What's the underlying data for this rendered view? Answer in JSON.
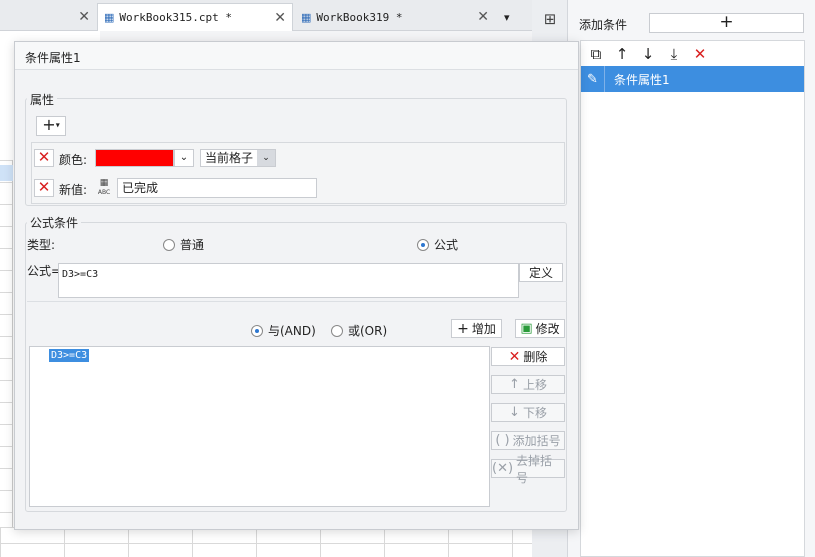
{
  "tabs": [
    {
      "label": "",
      "active": false
    },
    {
      "label": "WorkBook315.cpt *",
      "active": true
    },
    {
      "label": "WorkBook319 *",
      "active": false
    }
  ],
  "panel": {
    "add_condition_label": "添加条件",
    "add_condition_button": "+",
    "items": [
      {
        "label": "条件属性1",
        "selected": true
      }
    ]
  },
  "dialog": {
    "title": "条件属性1",
    "attributes": {
      "title": "属性",
      "add_button": "+",
      "color_label": "颜色:",
      "color_value": "#ff0000",
      "scope_value": "当前格子",
      "new_value_label": "新值:",
      "new_value_icon_text": "ABC",
      "new_value": "已完成"
    },
    "formula_condition": {
      "title": "公式条件",
      "type_label": "类型:",
      "type_normal": "普通",
      "type_formula": "公式",
      "selected_type": "公式",
      "formula_label": "公式=",
      "formula_value": "D3>=C3",
      "define_button": "定义",
      "and_label": "与(AND)",
      "or_label": "或(OR)",
      "selected_logic": "与(AND)",
      "add_button": "增加",
      "modify_button": "修改",
      "delete_button": "删除",
      "move_up_button": "上移",
      "move_down_button": "下移",
      "add_bracket_button": "添加括号",
      "remove_bracket_button": "去掉括号",
      "conditions": [
        "D3>=C3"
      ]
    }
  },
  "colors": {
    "accent": "#3d8ee0",
    "danger": "#d92020",
    "success": "#2a9b3a"
  }
}
